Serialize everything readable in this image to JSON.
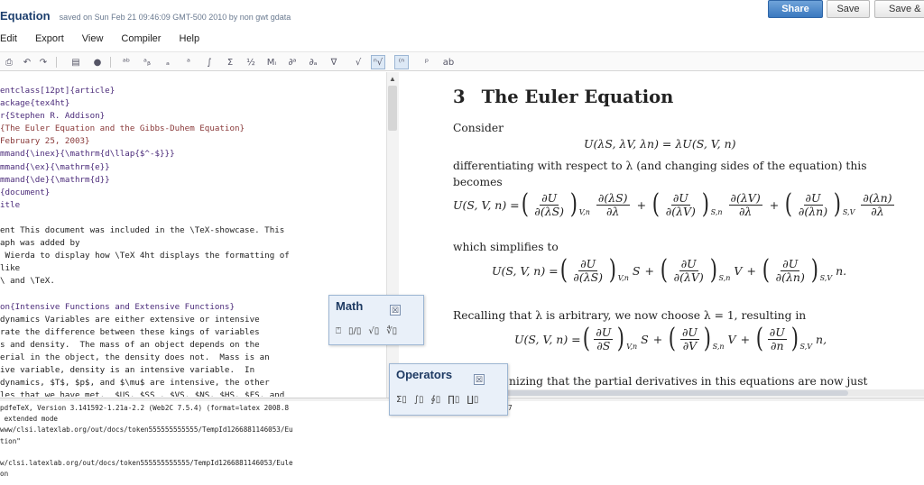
{
  "app": {
    "logo_text": "",
    "doc_title": "Equation",
    "saved_info": "saved on Sun Feb 21 09:46:09 GMT-500 2010 by non gwt gdata"
  },
  "top_buttons": {
    "share": "Share",
    "save": "Save",
    "save_as": "Save & C"
  },
  "menu": [
    "Edit",
    "Export",
    "View",
    "Compiler",
    "Help"
  ],
  "toolbar_icons": [
    "print-icon",
    "undo-icon",
    "redo-icon",
    "outline-icon",
    "record-icon",
    "symbol-abc-icon",
    "symbol-var-icon",
    "symbol-sub-icon",
    "symbol-sup-icon",
    "symbol-int-icon",
    "symbol-sum-icon",
    "symbol-frac-icon",
    "symbol-m-icon",
    "symbol-deriv-icon",
    "symbol-partial-icon",
    "symbol-nabla-icon",
    "sqrt-icon",
    "nth-root-icon",
    "symbol-bracket-icon",
    "symbol-rho-icon",
    "symbol-ab-icon"
  ],
  "toolbar_glyphs": [
    "⎙",
    "↶",
    "↷",
    "▤",
    "●",
    "ᵃᵇ",
    "ᵃᵦ",
    "ₐ",
    "ᵃ",
    "∫",
    "Σ",
    "½",
    "Mᵢ",
    "∂ᵃ",
    "∂ₐ",
    "∇",
    "√",
    "ⁿ√",
    "⁽ⁿ",
    "ᵖ",
    "ab"
  ],
  "editor": {
    "lines": [
      [
        "kw",
        "entclass[12pt]{article}"
      ],
      [
        "kw",
        "ackage{tex4ht}"
      ],
      [
        "kw",
        "r{Stephen R. Addison}"
      ],
      [
        "arg",
        "{The Euler Equation and the Gibbs-Duhem Equation}"
      ],
      [
        "arg",
        "February 25, 2003}"
      ],
      [
        "kw",
        "mmand{\\inex}{\\mathrm{d\\llap{$^-$}}}"
      ],
      [
        "kw",
        "mmand{\\ex}{\\mathrm{e}}"
      ],
      [
        "kw",
        "mmand{\\de}{\\mathrm{d}}"
      ],
      [
        "kw",
        "{document}"
      ],
      [
        "kw",
        "itle"
      ],
      [
        "gap",
        ""
      ],
      [
        "plain",
        "ent This document was included in the \\TeX-showcase. This"
      ],
      [
        "plain",
        "aph was added by"
      ],
      [
        "plain",
        " Wierda to display how \\TeX 4ht displays the formatting of"
      ],
      [
        "plain",
        "like"
      ],
      [
        "plain",
        "\\ and \\TeX."
      ],
      [
        "gap",
        ""
      ],
      [
        "kw",
        "on{Intensive Functions and Extensive Functions}"
      ],
      [
        "plain",
        "dynamics Variables are either extensive or intensive"
      ],
      [
        "plain",
        "rate the difference between these kings of variables"
      ],
      [
        "plain",
        "s and density.  The mass of an object depends on the"
      ],
      [
        "plain",
        "erial in the object, the density does not.  Mass is an"
      ],
      [
        "plain",
        "ive variable, density is an intensive variable.  In"
      ],
      [
        "plain",
        "dynamics, $T$, $p$, and $\\mu$ are intensive, the other"
      ],
      [
        "plain",
        "les that we have met.  $US. $SS . $VS. $NS. $HS. $FS. and"
      ]
    ]
  },
  "preview": {
    "section_number": "3",
    "section_title": "The Euler Equation",
    "p_consider": "Consider",
    "eq1": "U(λS, λV, λn) = λU(S, V, n)",
    "p_diff": "differentiating with respect to λ (and changing sides of the equation) this",
    "p_becomes": "becomes",
    "p_simplifies": "which simplifies to",
    "p_recalling": "Recalling that λ is arbitrary, we now choose λ = 1, resulting in",
    "p_recognizing": "nizing that the partial derivatives in this equations are now just"
  },
  "log": {
    "lines": [
      "pdfeTeX, Version 3.141592-1.21a-2.2 (Web2C 7.5.4) (format=latex 2008.8",
      " extended mode",
      "www/clsi.latexlab.org/out/docs/token555555555555/TempId1266881146053/Eu",
      "tion\"",
      "",
      "w/clsi.latexlab.org/out/docs/token555555555555/TempId1266881146053/Eule",
      "on"
    ],
    "trailing_fragment": "7"
  },
  "math_palette": {
    "title": "Math",
    "close": "☒",
    "items": [
      "⍞",
      "▯/▯",
      "√▯",
      "∜▯"
    ]
  },
  "ops_palette": {
    "title": "Operators",
    "close": "☒",
    "items": [
      "Σ▯",
      "∫▯",
      "∮▯",
      "∏▯",
      "∐▯"
    ]
  }
}
